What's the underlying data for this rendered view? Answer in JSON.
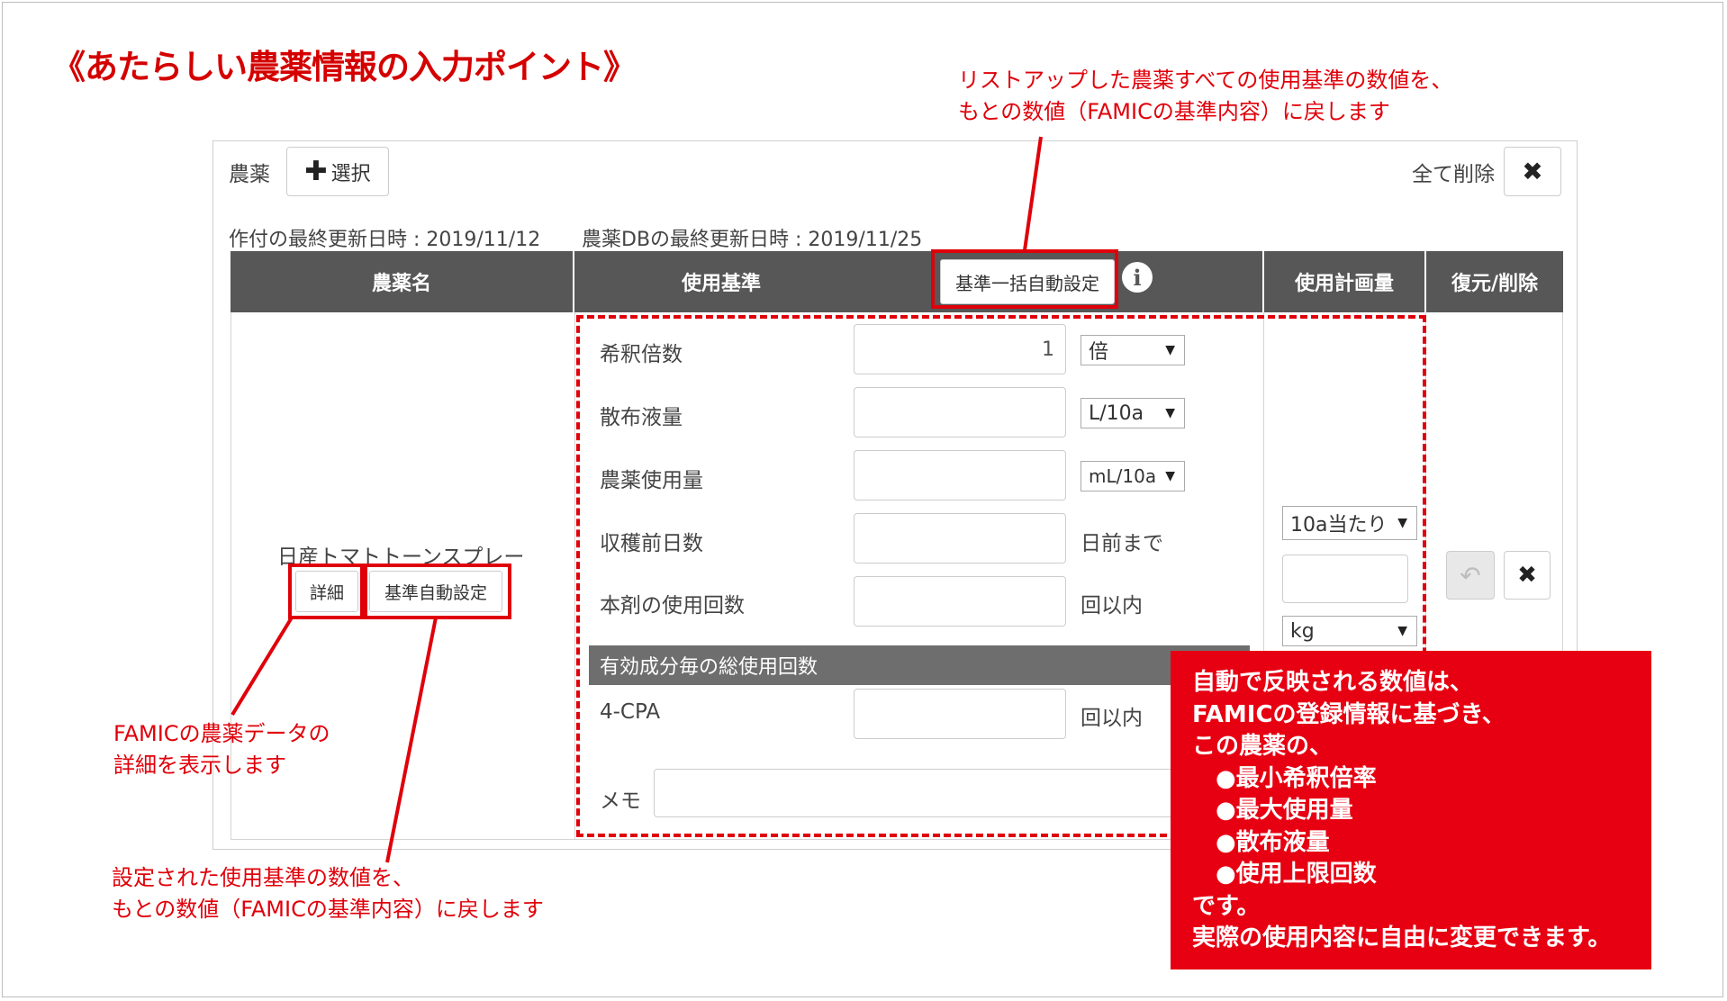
{
  "page": {
    "title": "《あたらしい農薬情報の入力ポイント》"
  },
  "callouts": {
    "top_line1": "リストアップした農薬すべての使用基準の数値を、",
    "top_line2": "もとの数値（FAMICの基準内容）に戻します",
    "detail_line1": "FAMICの農薬データの",
    "detail_line2": "詳細を表示します",
    "bottom_line1": "設定された使用基準の数値を、",
    "bottom_line2": "もとの数値（FAMICの基準内容）に戻します"
  },
  "infobox": {
    "lines": [
      "自動で反映される数値は、",
      "FAMICの登録情報に基づき、",
      "この農薬の、",
      "　●最小希釈倍率",
      "　●最大使用量",
      "　●散布液量",
      "　●使用上限回数",
      "です。",
      "実際の使用内容に自由に変更できます。"
    ]
  },
  "panel": {
    "pesticide_label": "農薬",
    "select_button": "選択",
    "delete_all_label": "全て削除",
    "updated_sakuzuke": "作付の最終更新日時 : 2019/11/12",
    "updated_db": "農薬DBの最終更新日時 : 2019/11/25"
  },
  "table": {
    "headers": {
      "name": "農薬名",
      "standard": "使用基準",
      "bulk_auto": "基準一括自動設定",
      "plan": "使用計画量",
      "restore_delete": "復元/削除"
    },
    "row": {
      "pesticide_name": "日産トマトトーンスプレー",
      "detail_button": "詳細",
      "auto_button": "基準自動設定",
      "fields": [
        {
          "label": "希釈倍数",
          "value": "1",
          "unit_select": "倍"
        },
        {
          "label": "散布液量",
          "value": "",
          "unit_select": "L/10a"
        },
        {
          "label": "農薬使用量",
          "value": "",
          "unit_select": "mL/10a"
        },
        {
          "label": "収穫前日数",
          "value": "",
          "unit_text": "日前まで"
        },
        {
          "label": "本剤の使用回数",
          "value": "",
          "unit_text": "回以内"
        }
      ],
      "ingredient_header": "有効成分毎の総使用回数",
      "ingredient": {
        "label": "4-CPA",
        "value": "",
        "unit_text": "回以内"
      },
      "memo_label": "メモ",
      "plan_basis_select": "10a当たり",
      "plan_value": "",
      "plan_unit_select": "kg"
    }
  },
  "colors": {
    "accent_red": "#e0000a",
    "header_bg": "#575757",
    "infobox_bg": "#e60012"
  }
}
